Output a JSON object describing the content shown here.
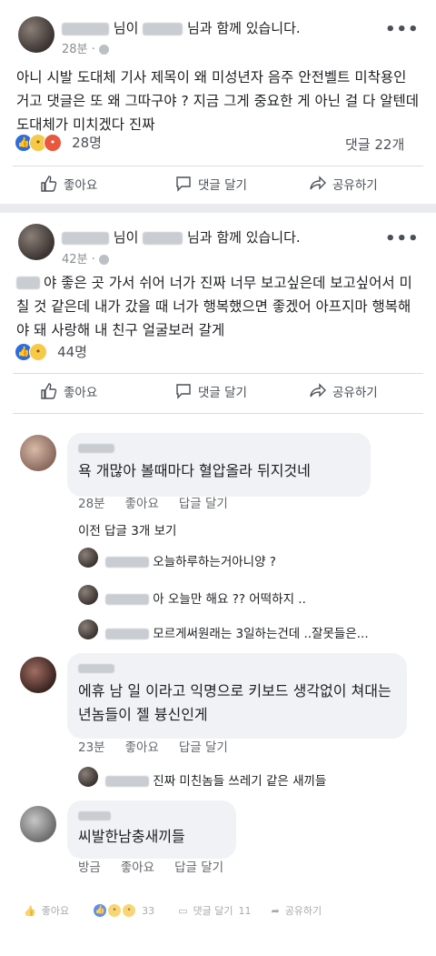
{
  "post1": {
    "header_suffix1": "님이",
    "header_suffix2": "님과 함께 있습니다.",
    "time": "28분 · ",
    "text": "아니 시발 도대체 기사 제목이 왜 미성년자 음주 안전벨트 미착용인 거고 댓글은 또 왜 그따구야 ? 지금 그게 중요한 게 아닌 걸 다 알텐데 도대체가 미치겠다 진짜",
    "reactions_count": "28명",
    "comments_count": "댓글 22개"
  },
  "post2": {
    "header_suffix1": "님이",
    "header_suffix2": "님과 함께 있습니다.",
    "time": "42분 · ",
    "text": "야 좋은 곳 가서 쉬어 너가 진짜 너무 보고싶은데 보고싶어서 미칠 것 같은데 내가 갔을 때 너가 행복했으면 좋겠어 아프지마 행복해야 돼 사랑해 내 친구 얼굴보러 갈게",
    "reactions_count": "44명"
  },
  "actions": {
    "like": "좋아요",
    "comment": "댓글 달기",
    "share": "공유하기"
  },
  "comment1": {
    "text": "욕 개많아 볼때마다 혈압올라 뒤지것네",
    "time": "28분",
    "like": "좋아요",
    "reply": "답글 달기"
  },
  "view_replies": "이전 답글 3개 보기",
  "replies": [
    {
      "text": "오늘하루하는거아니양 ?"
    },
    {
      "text": "아 오늘만 해요 ?? 어떡하지 .."
    },
    {
      "text": "모르게써원래는 3일하는건데 ..잘못들은..."
    }
  ],
  "comment2": {
    "text": "에휴 남 일 이라고 익명으로 키보드 생각없이 쳐대는 년놈들이 젤 븅신인게",
    "time": "23분",
    "like": "좋아요",
    "reply": "답글 달기"
  },
  "reply4": {
    "text": "진짜 미친놈들 쓰레기 같은 새끼들"
  },
  "comment3": {
    "text": "씨발한남충새끼들",
    "time": "방금",
    "like": "좋아요",
    "reply": "답글 달기"
  },
  "footer": {
    "like": "좋아요",
    "count": "33",
    "comment": "댓글 달기",
    "comment_count": "11",
    "share": "공유하기"
  },
  "colors": {
    "like_blue": "#2d6cdf",
    "gray_text": "#65676b",
    "bubble": "#f0f2f5"
  }
}
